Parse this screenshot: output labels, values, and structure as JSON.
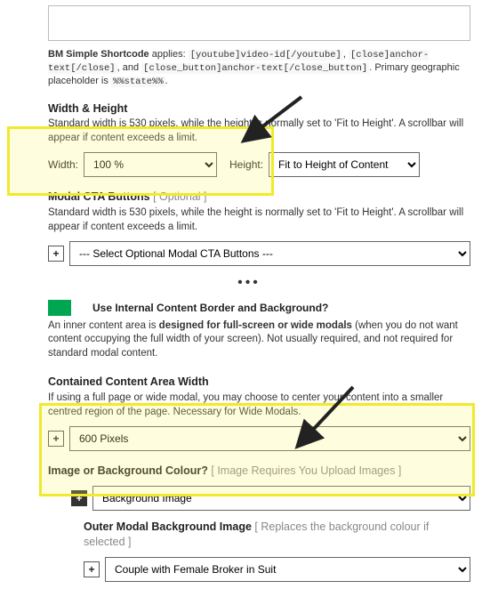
{
  "shortcode": {
    "label": "BM Simple Shortcode",
    "verb": "applies:",
    "code1": "[youtube]video-id[/youtube]",
    "code2": "[close]anchor-text[/close]",
    "sep": ", and",
    "code3": "[close_button]anchor-text[/close_button]",
    "tail": ". Primary geographic placeholder is ",
    "placeholder": "%%state%%",
    "period": "."
  },
  "wh": {
    "title": "Width & Height",
    "desc1": "Standard width is 530 pixels, while the height is normally set to 'Fit to Height'. A scrollbar will appear if content exceeds a limit.",
    "widthLabel": "Width:",
    "widthValue": "100 %",
    "heightLabel": "Height:",
    "heightValue": "Fit to Height of Content"
  },
  "cta": {
    "title": "Modal CTA Buttons",
    "opt": "[ Optional ]",
    "desc": "Standard width is 530 pixels, while the height is normally set to 'Fit to Height'. A scrollbar will appear if content exceeds a limit.",
    "selectValue": "--- Select Optional Modal CTA Buttons ---"
  },
  "border": {
    "toggleLabel": "Use Internal Content Border and Background?",
    "desc1a": "An inner content area is ",
    "desc1b": "designed for full-screen or wide modals",
    "desc1c": " (when you do not want content occupying the full width of your screen). Not usually required, and not required for standard modal content."
  },
  "contained": {
    "title": "Contained Content Area Width",
    "desc": "If using a full page or wide modal, you may choose to center your content into a smaller centred region of the page. Necessary for Wide Modals.",
    "selectValue": "600 Pixels"
  },
  "imgbg": {
    "title": "Image or Background Colour?",
    "opt": "[ Image Requires You Upload Images ]",
    "selectValue": "Background Image"
  },
  "outer": {
    "title": "Outer Modal Background Image",
    "opt": "[ Replaces the background colour if selected ]",
    "selectValue": "Couple with Female Broker in Suit"
  }
}
